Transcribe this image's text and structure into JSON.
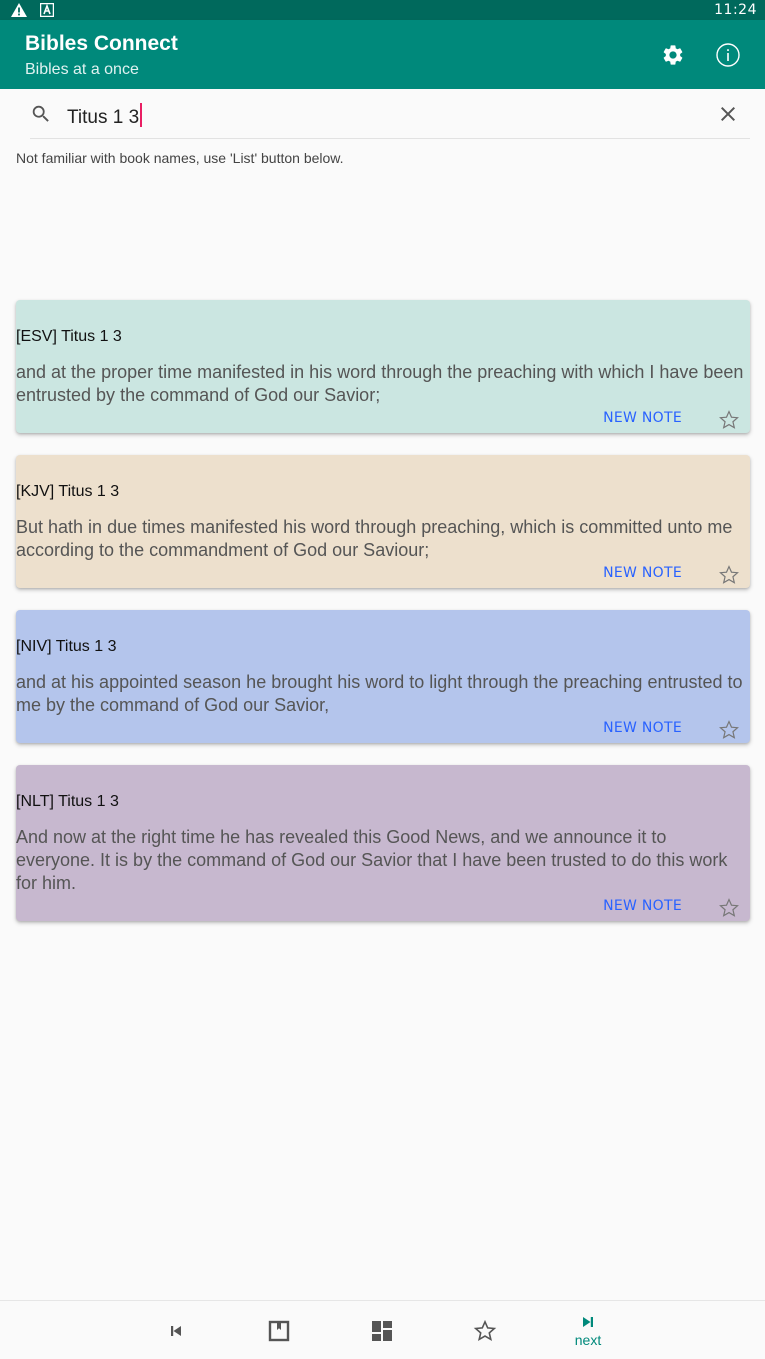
{
  "status_bar": {
    "time": "11:24",
    "icons": [
      "warning-icon",
      "font-icon"
    ]
  },
  "app_bar": {
    "title": "Bibles Connect",
    "subtitle": "Bibles at a once",
    "actions": [
      "settings-icon",
      "info-icon"
    ],
    "color": "#00897b"
  },
  "search": {
    "value": "Titus 1 3",
    "clear_icon": "close-icon"
  },
  "hint": "Not familiar with book names, use 'List' button below.",
  "verses": [
    {
      "reference": "[ESV] Titus 1 3",
      "text": "and at the proper time manifested in his word through the preaching with which I have been entrusted by the command of God our Savior;",
      "note_label": "NEW NOTE",
      "color": "#cbe6e1"
    },
    {
      "reference": "[KJV] Titus 1 3",
      "text": "But hath in due times manifested his word through preaching, which is committed unto me according to the commandment of God our Saviour;",
      "note_label": "NEW NOTE",
      "color": "#ede0cd"
    },
    {
      "reference": "[NIV] Titus 1 3",
      "text": "and at his appointed season he brought his word to light through the preaching entrusted to me by the command of God our Savior,",
      "note_label": "NEW NOTE",
      "color": "#b4c5ec"
    },
    {
      "reference": "[NLT] Titus 1 3",
      "text": "And now at the right time he has revealed this Good News, and we announce it to everyone. It is by the command of God our Savior that I have been trusted to do this work for him.",
      "note_label": "NEW NOTE",
      "color": "#c7b8cf"
    }
  ],
  "bottom_nav": {
    "items": [
      {
        "icon": "skip-previous-icon",
        "label": ""
      },
      {
        "icon": "book-icon",
        "label": ""
      },
      {
        "icon": "dashboard-icon",
        "label": ""
      },
      {
        "icon": "star-icon",
        "label": ""
      },
      {
        "icon": "skip-next-icon",
        "label": "next"
      }
    ],
    "active_color": "#00897b"
  }
}
